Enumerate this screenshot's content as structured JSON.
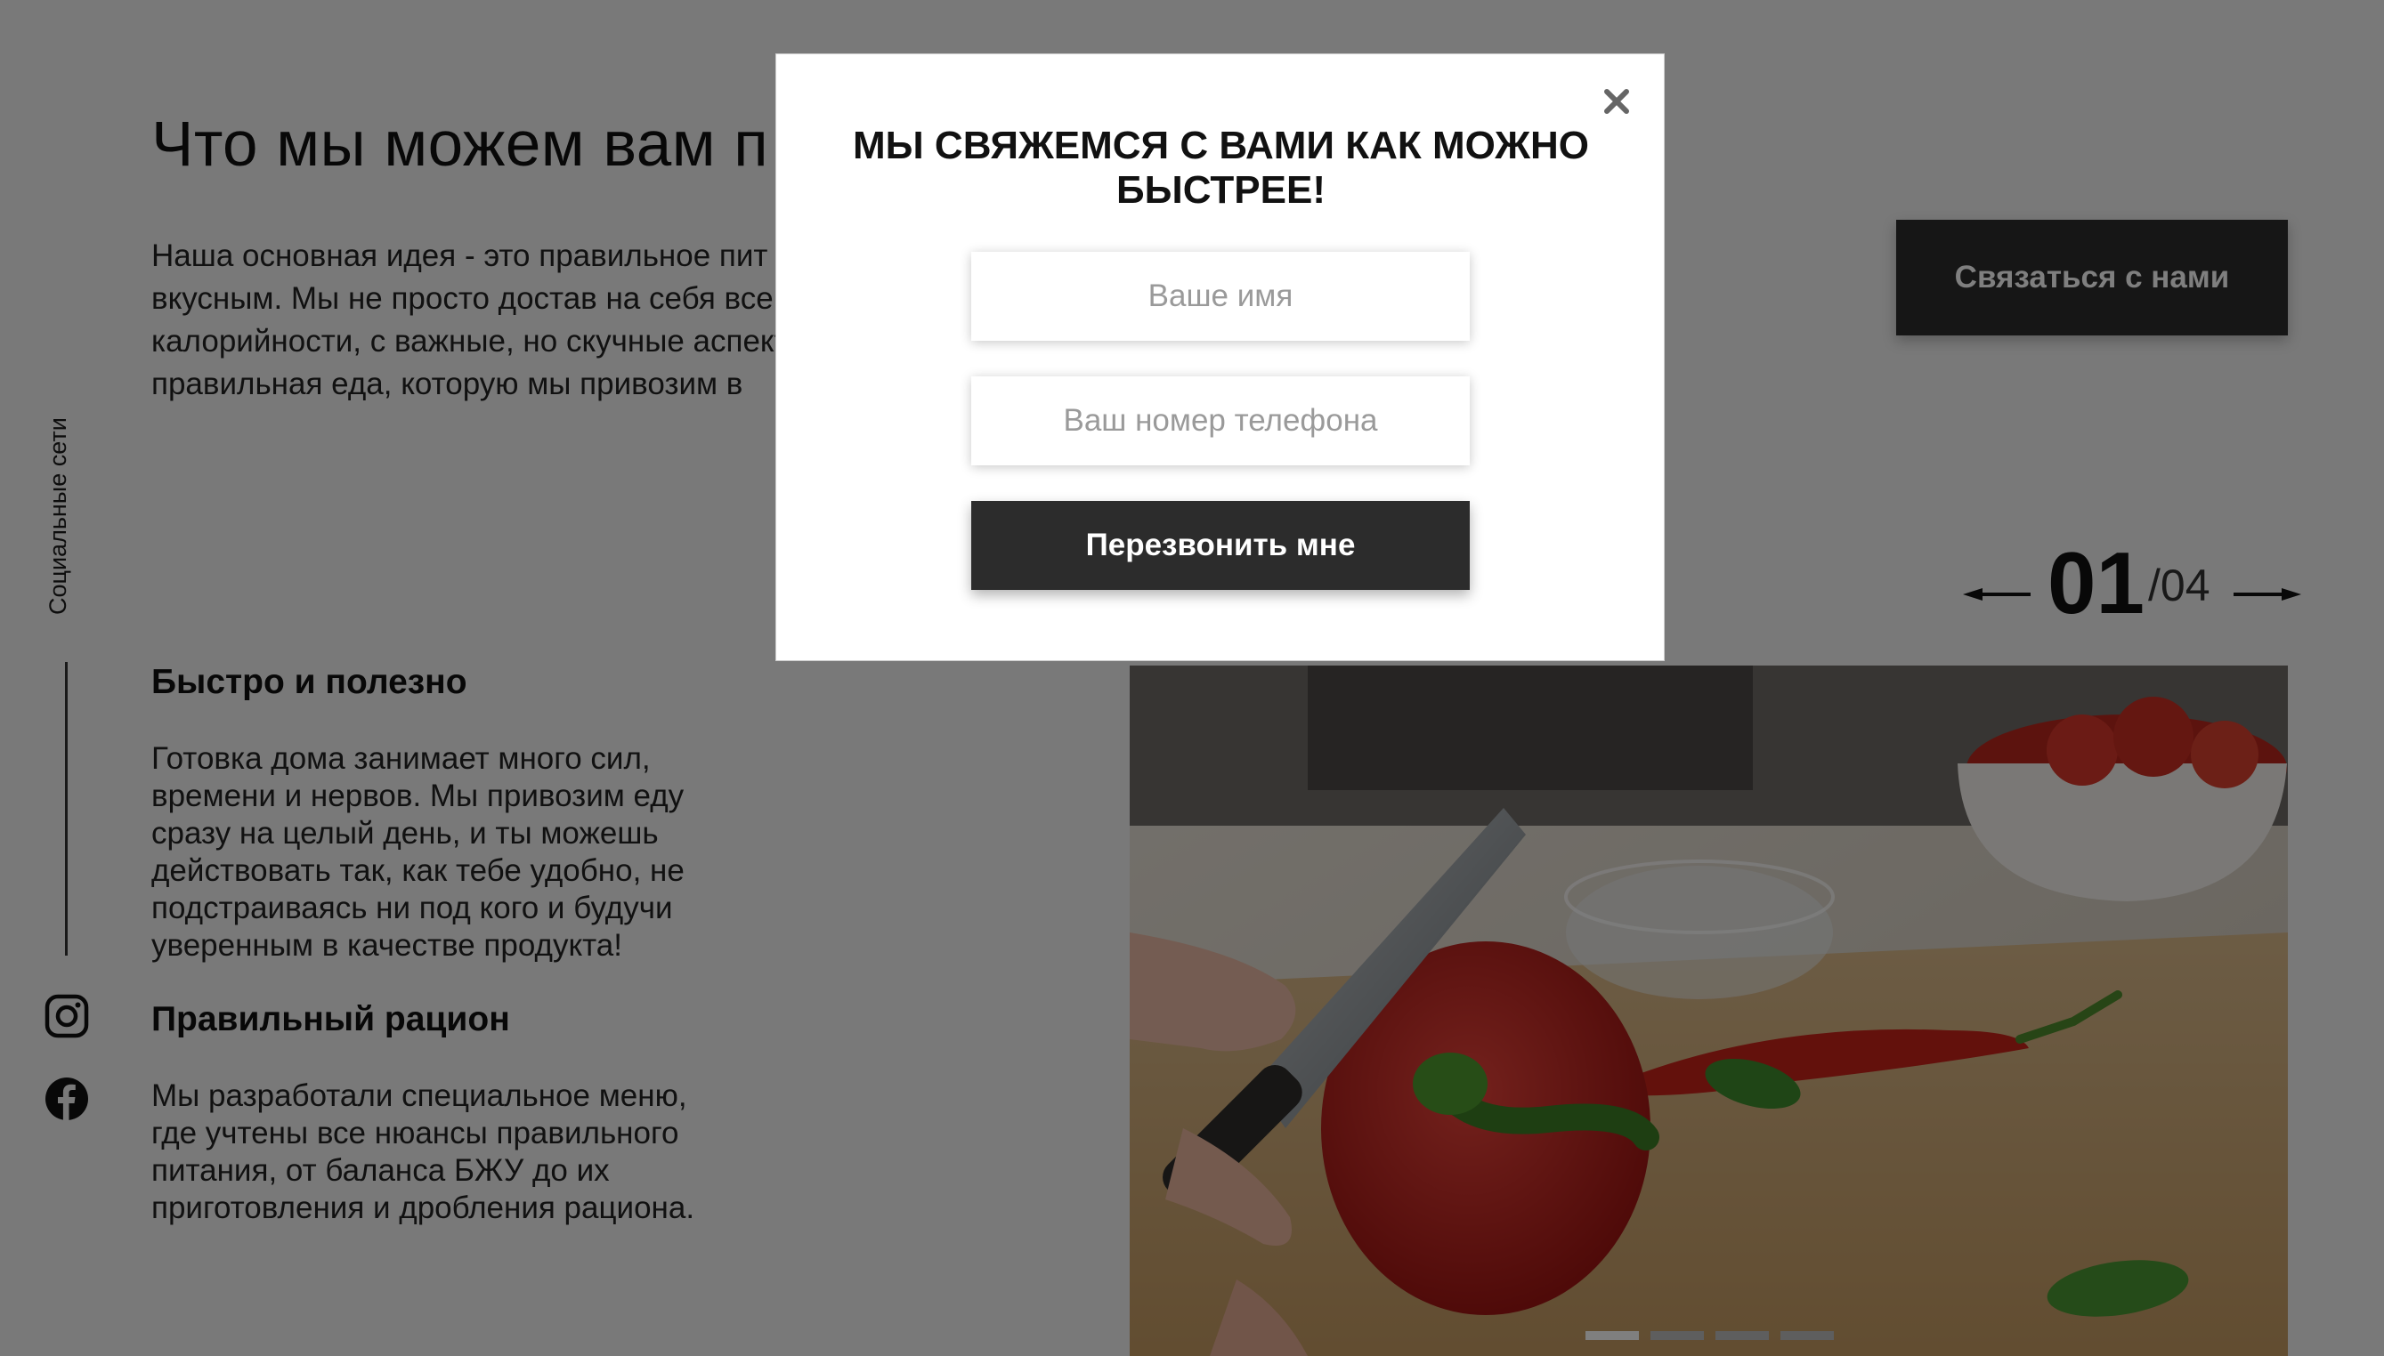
{
  "social": {
    "label": "Социальные сети",
    "icons": [
      "instagram-icon",
      "facebook-icon"
    ]
  },
  "main": {
    "title": "Что мы можем вам п",
    "intro": "Наша основная идея - это правильное пит простым и вкусным. Мы не просто достав на себя все расчеты БЖУ, калорийности, с важные, но скучные аспекты. Вам остаетс и правильная еда, которую мы привозим в",
    "contact_button": "Связаться с нами",
    "features": [
      {
        "title": "Быстро и полезно",
        "text": "Готовка дома занимает много сил, времени и нервов. Мы привозим еду сразу на целый день, и ты можешь действовать так, как тебе удобно, не подстраиваясь ни под кого и будучи уверенным в качестве продукта!"
      },
      {
        "title": "Правильный рацион",
        "text": "Мы разработали специальное меню, где учтены все нюансы правильного питания, от баланса БЖУ до их приготовления и дробления рациона."
      }
    ]
  },
  "slider": {
    "current": "01",
    "total": "/04",
    "active_index": 1,
    "dot_count": 4
  },
  "modal": {
    "title": "МЫ СВЯЖЕМСЯ С ВАМИ КАК МОЖНО БЫСТРЕЕ!",
    "name_placeholder": "Ваше имя",
    "phone_placeholder": "Ваш номер телефона",
    "submit_label": "Перезвонить мне"
  },
  "colors": {
    "button_bg": "#2c2c2c",
    "overlay": "rgba(0,0,0,0.5)",
    "modal_bg": "#ffffff"
  }
}
